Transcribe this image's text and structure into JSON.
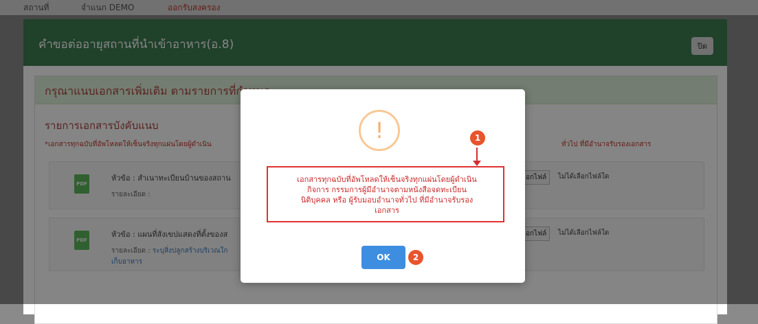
{
  "topnav": {
    "items": [
      "สถานที่",
      "จำแนก DEMO",
      "ออกรับสงครอง"
    ]
  },
  "outer_modal": {
    "title": "คำขอต่ออายุสถานที่นำเข้าอาหาร(อ.8)",
    "close_label": "ปิด"
  },
  "inner_panel": {
    "title": "กรุณาแนบเอกสารเพิ่มเติม ตามรายการที่กำหนด",
    "section_title": "รายการเอกสารบังคับแนบ",
    "notice": "*เอกสารทุกฉบับที่อัพโหลดให้เซ็นจริงทุกแผ่นโดยผู้ดำเนิน",
    "notice_right": "ทั่วไป ที่มีอำนาจรับรองเอกสาร"
  },
  "documents": [
    {
      "topic": "หัวข้อ : สำเนาทะเบียนบ้านของสถาน",
      "detail_label": "รายละเอียด :",
      "detail_text": "",
      "detail_text_2": "",
      "file_button": "อกไฟล์",
      "no_file": "ไม่ได้เลือกไฟล์ใด",
      "icon": "pdf-file-icon",
      "icon_text": "PDF"
    },
    {
      "topic": "หัวข้อ : แผนที่สังเขปแสดงที่ตั้งของส",
      "detail_label": "รายละเอียด :",
      "detail_text": "ระบุสิ่งปลูกสร้างบริเวณใก",
      "detail_text_2": "เก็บอาหาร",
      "file_button": "อกไฟล์",
      "no_file": "ไม่ได้เลือกไฟล์ใด",
      "icon": "pdf-file-icon",
      "icon_text": "PDF"
    }
  ],
  "dialog": {
    "icon": "exclamation-warning-icon",
    "icon_glyph": "!",
    "message_lines": [
      "เอกสารทุกฉบับที่อัพโหลดให้เซ็นจริงทุกแผ่นโดยผู้ดำเนิน",
      "กิจการ กรรมการผู้มีอำนาจตามหนังสือจดทะเบียน",
      "นิติบุคคล หรือ ผู้รับมอบอำนาจทั่วไป ที่มีอำนาจรับรอง",
      "เอกสาร"
    ],
    "ok_label": "OK"
  },
  "markers": [
    "1",
    "2"
  ],
  "colors": {
    "header_green": "#3f7d51",
    "panel_green": "#dff0d8",
    "alert_red": "#e03131",
    "ok_blue": "#3d8ee0",
    "marker_orange": "#e8542c",
    "warning_orange": "#f8c895"
  }
}
